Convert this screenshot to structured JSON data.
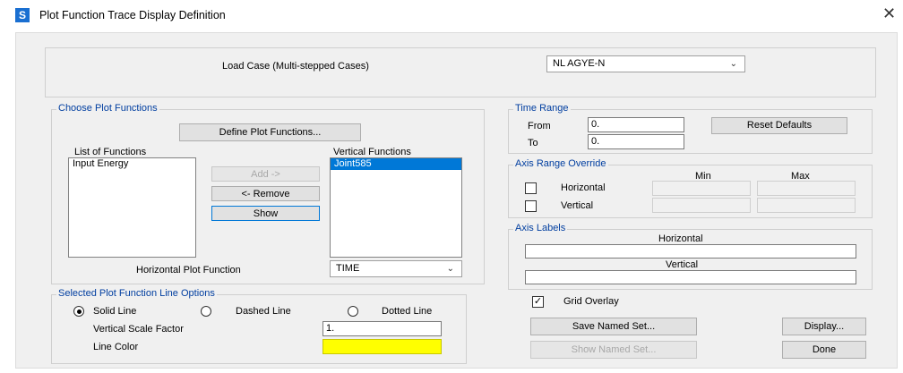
{
  "window": {
    "app_icon_letter": "S",
    "title": "Plot Function Trace Display Definition",
    "close_symbol": "✕"
  },
  "load_case": {
    "label": "Load Case (Multi-stepped Cases)",
    "selected": "NL AGYE-N"
  },
  "choose_plot_functions": {
    "group_title": "Choose Plot Functions",
    "define_button": "Define Plot Functions...",
    "list_of_functions_label": "List of Functions",
    "list_of_functions": [
      "Input Energy"
    ],
    "vertical_functions_label": "Vertical Functions",
    "vertical_functions": [
      "Joint585"
    ],
    "add_button": "Add ->",
    "remove_button": "<- Remove",
    "show_button": "Show",
    "horizontal_plot_function_label": "Horizontal Plot Function",
    "horizontal_plot_function_selected": "TIME"
  },
  "line_options": {
    "group_title": "Selected Plot Function Line Options",
    "solid_label": "Solid Line",
    "dashed_label": "Dashed Line",
    "dotted_label": "Dotted Line",
    "selected_style": "solid",
    "scale_factor_label": "Vertical  Scale Factor",
    "scale_factor_value": "1.",
    "line_color_label": "Line Color",
    "line_color": "#ffff00"
  },
  "time_range": {
    "group_title": "Time Range",
    "from_label": "From",
    "from_value": "0.",
    "to_label": "To",
    "to_value": "0.",
    "reset_button": "Reset Defaults"
  },
  "axis_range_override": {
    "group_title": "Axis Range Override",
    "min_label": "Min",
    "max_label": "Max",
    "horizontal_label": "Horizontal",
    "vertical_label": "Vertical"
  },
  "axis_labels": {
    "group_title": "Axis Labels",
    "horizontal_label": "Horizontal",
    "horizontal_value": "",
    "vertical_label": "Vertical",
    "vertical_value": ""
  },
  "grid_overlay": {
    "label": "Grid Overlay",
    "checked": true
  },
  "buttons": {
    "save_named_set": "Save Named Set...",
    "show_named_set": "Show Named Set...",
    "display": "Display...",
    "done": "Done"
  },
  "colors": {
    "group_title": "#003ea0",
    "selection": "#0078d7",
    "app_icon": "#1a6fd1"
  }
}
